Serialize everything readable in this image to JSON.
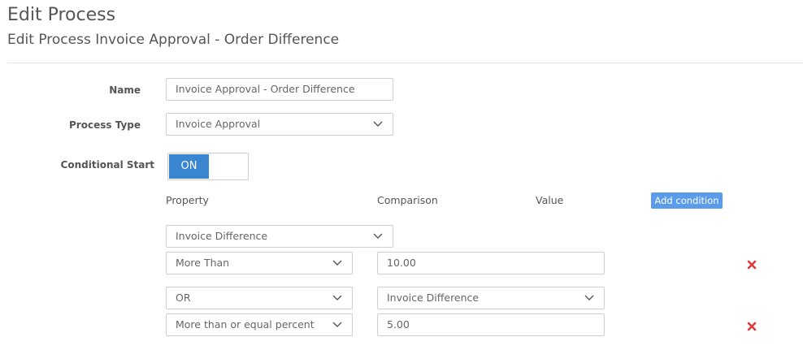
{
  "page": {
    "title": "Edit Process",
    "subtitle": "Edit Process Invoice Approval - Order Difference"
  },
  "form": {
    "name_label": "Name",
    "name_value": "Invoice Approval - Order Difference",
    "type_label": "Process Type",
    "type_value": "Invoice Approval",
    "conditional_label": "Conditional Start",
    "toggle_label": "ON"
  },
  "conditions": {
    "headers": {
      "property": "Property",
      "comparison": "Comparison",
      "value": "Value"
    },
    "add_label": "Add condition",
    "rows": [
      {
        "property": "Invoice Difference",
        "comparison": "More Than",
        "value": "10.00"
      },
      {
        "connector": "OR",
        "property": "Invoice Difference",
        "comparison": "More than or equal percent",
        "value": "5.00"
      }
    ]
  },
  "colors": {
    "accent": "#3b86d1",
    "add_button": "#5b9cea",
    "remove": "#e03a3a"
  },
  "icons": {
    "dropdown": "chevron-down-icon",
    "remove": "close-icon"
  }
}
